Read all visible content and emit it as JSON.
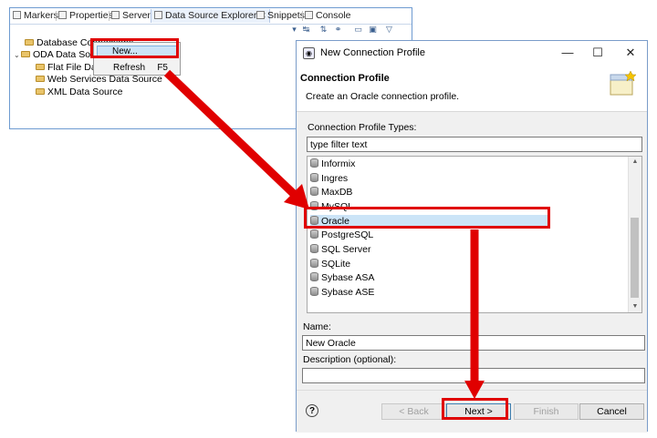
{
  "eclipse": {
    "tabs": [
      {
        "label": "Markers",
        "icon": "markers-icon"
      },
      {
        "label": "Properties",
        "icon": "properties-icon"
      },
      {
        "label": "Servers",
        "icon": "servers-icon"
      },
      {
        "label": "Data Source Explorer",
        "icon": "datasource-icon"
      },
      {
        "label": "Snippets",
        "icon": "snippets-icon"
      },
      {
        "label": "Console",
        "icon": "console-icon"
      }
    ],
    "active_tab_close": "✕",
    "tree": {
      "root1": "Database Connections",
      "root2": "ODA Data Sources",
      "children": [
        "Flat File Data Source",
        "Web Services Data Source",
        "XML Data Source"
      ]
    }
  },
  "context_menu": {
    "new_label": "New...",
    "refresh_label": "Refresh",
    "refresh_shortcut": "F5"
  },
  "dialog": {
    "title": "New Connection Profile",
    "header_title": "Connection Profile",
    "header_desc": "Create an Oracle connection profile.",
    "types_label": "Connection Profile Types:",
    "filter_value": "type filter text",
    "profile_types": [
      "Informix",
      "Ingres",
      "MaxDB",
      "MySQL",
      "Oracle",
      "PostgreSQL",
      "SQL Server",
      "SQLite",
      "Sybase ASA",
      "Sybase ASE"
    ],
    "selected_type": "Oracle",
    "name_label": "Name:",
    "name_value": "New Oracle",
    "description_label": "Description (optional):",
    "description_value": "",
    "buttons": {
      "back": "< Back",
      "next": "Next >",
      "finish": "Finish",
      "cancel": "Cancel"
    },
    "help": "?"
  },
  "colors": {
    "annotation": "#e00000",
    "selection": "#cce4f7"
  }
}
